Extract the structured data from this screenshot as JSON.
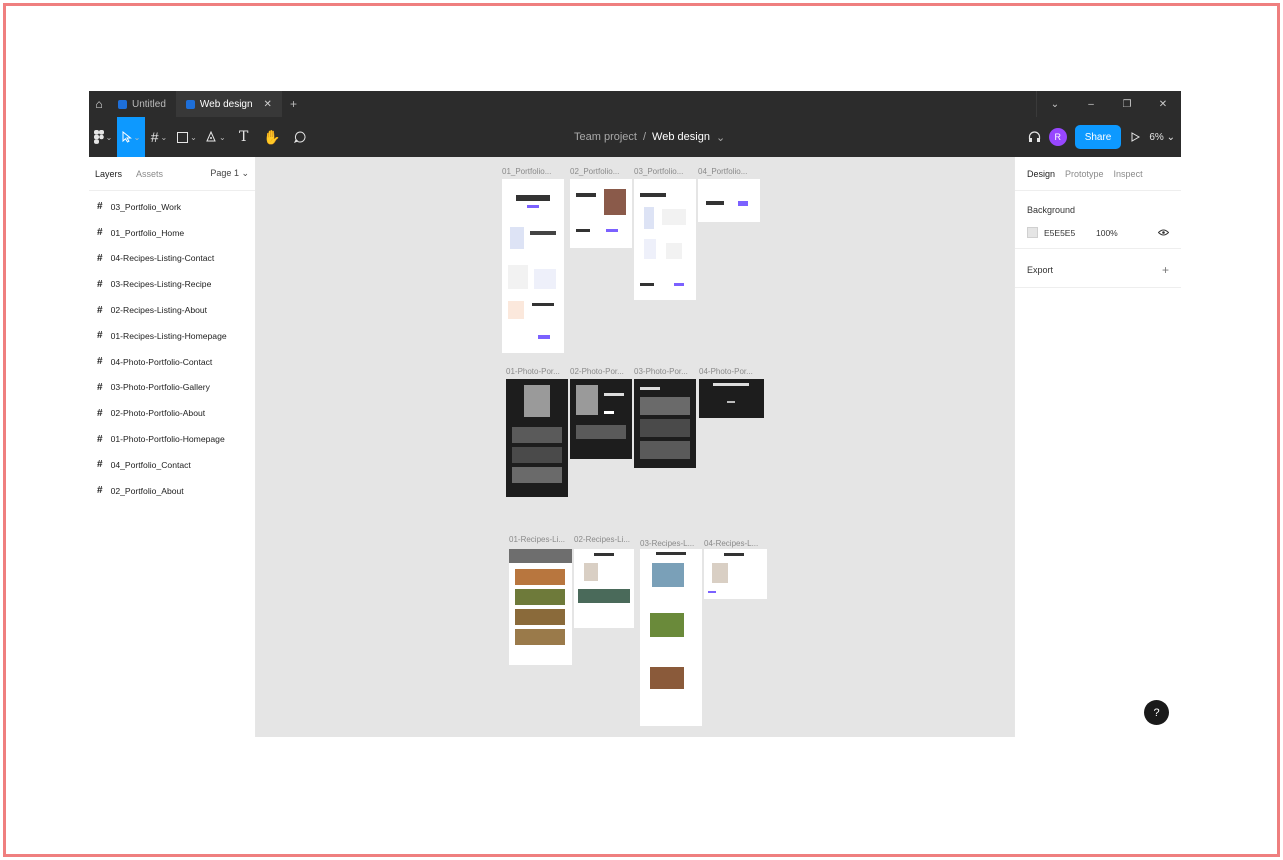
{
  "titlebar": {
    "tabs": [
      {
        "label": "Untitled",
        "active": false
      },
      {
        "label": "Web design",
        "active": true
      }
    ],
    "add_tab": "+",
    "window_controls": [
      "⌄",
      "–",
      "❐",
      "✕"
    ]
  },
  "toolbar": {
    "project": "Team project",
    "separator": "/",
    "file_name": "Web design",
    "file_caret": "⌄",
    "avatar_initial": "R",
    "share_label": "Share",
    "zoom": "6%"
  },
  "left_panel": {
    "tabs": [
      "Layers",
      "Assets"
    ],
    "page_selector": "Page 1 ⌄",
    "layers": [
      "03_Portfolio_Work",
      "01_Portfolio_Home",
      "04-Recipes-Listing-Contact",
      "03-Recipes-Listing-Recipe",
      "02-Recipes-Listing-About",
      "01-Recipes-Listing-Homepage",
      "04-Photo-Portfolio-Contact",
      "03-Photo-Portfolio-Gallery",
      "02-Photo-Portfolio-About",
      "01-Photo-Portfolio-Homepage",
      "04_Portfolio_Contact",
      "02_Portfolio_About"
    ]
  },
  "canvas": {
    "artboard_titles": [
      "01_Portfolio...",
      "02_Portfolio...",
      "03_Portfolio...",
      "04_Portfolio...",
      "01-Photo-Por...",
      "02-Photo-Por...",
      "03-Photo-Por...",
      "04-Photo-Por...",
      "01-Recipes-Li...",
      "02-Recipes-Li...",
      "03-Recipes-L...",
      "04-Recipes-L..."
    ]
  },
  "right_panel": {
    "tabs": [
      "Design",
      "Prototype",
      "Inspect"
    ],
    "background_label": "Background",
    "background_hex": "E5E5E5",
    "background_opacity": "100%",
    "export_label": "Export",
    "export_add": "+"
  },
  "help_label": "?",
  "colors": {
    "accent": "#0d99ff",
    "avatar": "#9747ff",
    "chrome": "#2c2c2c",
    "canvas": "#e5e5e5",
    "outer_border": "#ef7f7f"
  }
}
